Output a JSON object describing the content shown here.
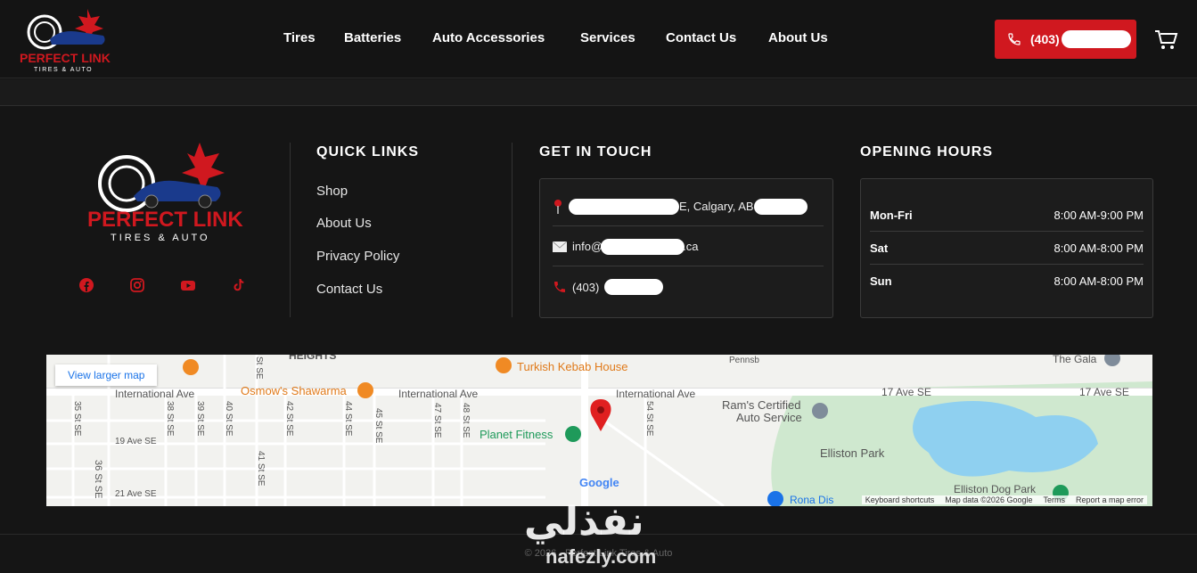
{
  "header": {
    "nav": [
      "Tires",
      "Batteries",
      "Auto Accessories",
      "Services",
      "Contact Us",
      "About Us"
    ],
    "phone_label": "(403)",
    "logo_text": "PERFECT LINK",
    "logo_sub": "TIRES & AUTO"
  },
  "footer": {
    "logo_text": "PERFECT LINK",
    "logo_sub": "TIRES & AUTO",
    "socials": [
      "facebook-icon",
      "instagram-icon",
      "youtube-icon",
      "tiktok-icon"
    ],
    "quick_links": {
      "title": "QUICK LINKS",
      "items": [
        "Shop",
        "About Us",
        "Privacy Policy",
        "Contact Us"
      ]
    },
    "get_in_touch": {
      "title": "GET IN TOUCH",
      "address": "E, Calgary, AB",
      "email_prefix": "info@",
      "email_suffix": ".ca",
      "phone": "(403)"
    },
    "opening_hours": {
      "title": "OPENING HOURS",
      "rows": [
        {
          "day": "Mon-Fri",
          "hours": "8:00 AM-9:00 PM"
        },
        {
          "day": "Sat",
          "hours": "8:00 AM-8:00 PM"
        },
        {
          "day": "Sun",
          "hours": "8:00 AM-8:00 PM"
        }
      ]
    },
    "map": {
      "view_larger": "View larger map",
      "labels": {
        "heights": "HEIGHTS",
        "turkish": "Turkish Kebab House",
        "osmow": "Osmow's Shawarma",
        "intl1": "International Ave",
        "intl2": "International Ave",
        "intl3": "International Ave",
        "ave17a": "17 Ave SE",
        "ave17b": "17 Ave SE",
        "rams": "Ram's Certified",
        "rams2": "Auto Service",
        "planet": "Planet Fitness",
        "elliston": "Elliston Park",
        "dogpark": "Elliston Dog Park",
        "gala": "The Gala",
        "pennsb": "Pennsb",
        "ave19": "19 Ave SE",
        "ave21": "21 Ave SE",
        "st36": "36 St SE",
        "rona": "Rona Dis",
        "google": "Google"
      },
      "streets": [
        "35 St SE",
        "38 St SE",
        "39 St SE",
        "40 St SE",
        "41 St SE",
        "42 St SE",
        "44 St SE",
        "45 St SE",
        "47 St SE",
        "48 St SE",
        "54 St SE",
        "St SE"
      ],
      "footer": [
        "Keyboard shortcuts",
        "Map data ©2026 Google",
        "Terms",
        "Report a map error"
      ]
    },
    "copyright": "© 2026 - Perfect Link Tires & Auto",
    "watermark": "نفذلي",
    "watermark_latin": "nafezly.com"
  },
  "colors": {
    "accent": "#d0181f",
    "bg": "#151515"
  }
}
